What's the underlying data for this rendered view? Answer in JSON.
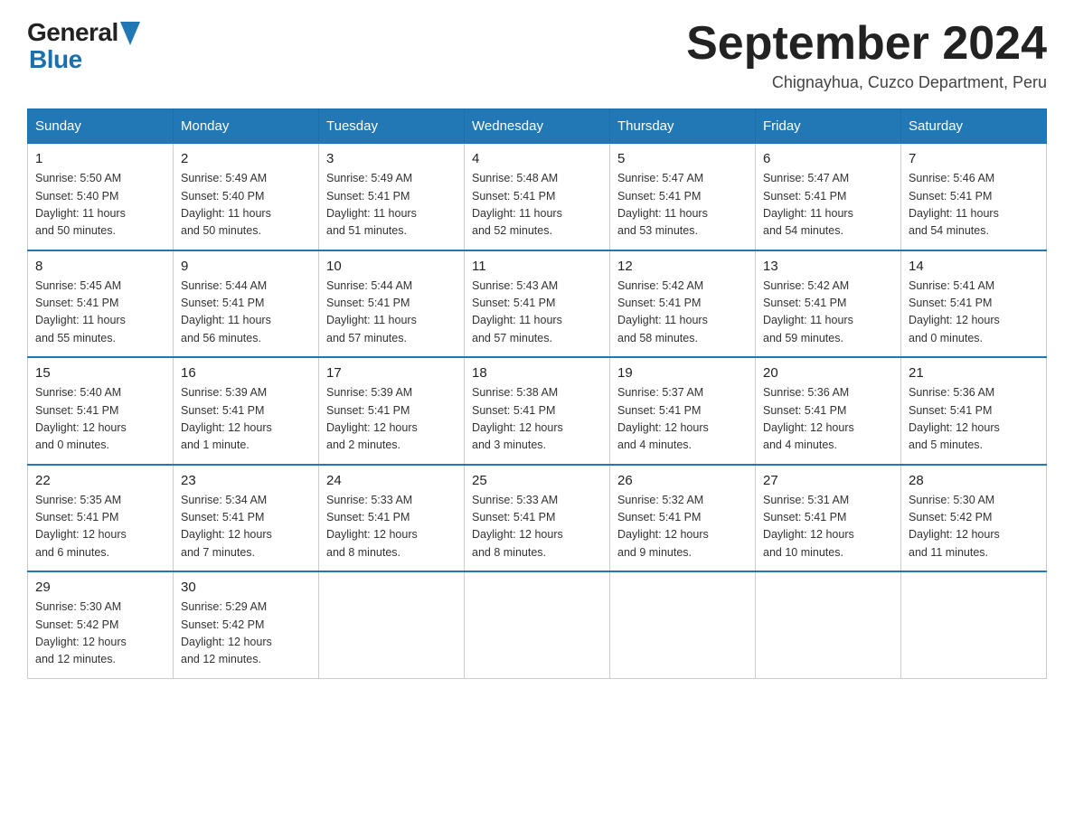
{
  "header": {
    "logo_general": "General",
    "logo_blue": "Blue",
    "title": "September 2024",
    "location": "Chignayhua, Cuzco Department, Peru"
  },
  "days_of_week": [
    "Sunday",
    "Monday",
    "Tuesday",
    "Wednesday",
    "Thursday",
    "Friday",
    "Saturday"
  ],
  "weeks": [
    [
      {
        "day": "1",
        "sunrise": "Sunrise: 5:50 AM",
        "sunset": "Sunset: 5:40 PM",
        "daylight": "Daylight: 11 hours and 50 minutes."
      },
      {
        "day": "2",
        "sunrise": "Sunrise: 5:49 AM",
        "sunset": "Sunset: 5:40 PM",
        "daylight": "Daylight: 11 hours and 50 minutes."
      },
      {
        "day": "3",
        "sunrise": "Sunrise: 5:49 AM",
        "sunset": "Sunset: 5:41 PM",
        "daylight": "Daylight: 11 hours and 51 minutes."
      },
      {
        "day": "4",
        "sunrise": "Sunrise: 5:48 AM",
        "sunset": "Sunset: 5:41 PM",
        "daylight": "Daylight: 11 hours and 52 minutes."
      },
      {
        "day": "5",
        "sunrise": "Sunrise: 5:47 AM",
        "sunset": "Sunset: 5:41 PM",
        "daylight": "Daylight: 11 hours and 53 minutes."
      },
      {
        "day": "6",
        "sunrise": "Sunrise: 5:47 AM",
        "sunset": "Sunset: 5:41 PM",
        "daylight": "Daylight: 11 hours and 54 minutes."
      },
      {
        "day": "7",
        "sunrise": "Sunrise: 5:46 AM",
        "sunset": "Sunset: 5:41 PM",
        "daylight": "Daylight: 11 hours and 54 minutes."
      }
    ],
    [
      {
        "day": "8",
        "sunrise": "Sunrise: 5:45 AM",
        "sunset": "Sunset: 5:41 PM",
        "daylight": "Daylight: 11 hours and 55 minutes."
      },
      {
        "day": "9",
        "sunrise": "Sunrise: 5:44 AM",
        "sunset": "Sunset: 5:41 PM",
        "daylight": "Daylight: 11 hours and 56 minutes."
      },
      {
        "day": "10",
        "sunrise": "Sunrise: 5:44 AM",
        "sunset": "Sunset: 5:41 PM",
        "daylight": "Daylight: 11 hours and 57 minutes."
      },
      {
        "day": "11",
        "sunrise": "Sunrise: 5:43 AM",
        "sunset": "Sunset: 5:41 PM",
        "daylight": "Daylight: 11 hours and 57 minutes."
      },
      {
        "day": "12",
        "sunrise": "Sunrise: 5:42 AM",
        "sunset": "Sunset: 5:41 PM",
        "daylight": "Daylight: 11 hours and 58 minutes."
      },
      {
        "day": "13",
        "sunrise": "Sunrise: 5:42 AM",
        "sunset": "Sunset: 5:41 PM",
        "daylight": "Daylight: 11 hours and 59 minutes."
      },
      {
        "day": "14",
        "sunrise": "Sunrise: 5:41 AM",
        "sunset": "Sunset: 5:41 PM",
        "daylight": "Daylight: 12 hours and 0 minutes."
      }
    ],
    [
      {
        "day": "15",
        "sunrise": "Sunrise: 5:40 AM",
        "sunset": "Sunset: 5:41 PM",
        "daylight": "Daylight: 12 hours and 0 minutes."
      },
      {
        "day": "16",
        "sunrise": "Sunrise: 5:39 AM",
        "sunset": "Sunset: 5:41 PM",
        "daylight": "Daylight: 12 hours and 1 minute."
      },
      {
        "day": "17",
        "sunrise": "Sunrise: 5:39 AM",
        "sunset": "Sunset: 5:41 PM",
        "daylight": "Daylight: 12 hours and 2 minutes."
      },
      {
        "day": "18",
        "sunrise": "Sunrise: 5:38 AM",
        "sunset": "Sunset: 5:41 PM",
        "daylight": "Daylight: 12 hours and 3 minutes."
      },
      {
        "day": "19",
        "sunrise": "Sunrise: 5:37 AM",
        "sunset": "Sunset: 5:41 PM",
        "daylight": "Daylight: 12 hours and 4 minutes."
      },
      {
        "day": "20",
        "sunrise": "Sunrise: 5:36 AM",
        "sunset": "Sunset: 5:41 PM",
        "daylight": "Daylight: 12 hours and 4 minutes."
      },
      {
        "day": "21",
        "sunrise": "Sunrise: 5:36 AM",
        "sunset": "Sunset: 5:41 PM",
        "daylight": "Daylight: 12 hours and 5 minutes."
      }
    ],
    [
      {
        "day": "22",
        "sunrise": "Sunrise: 5:35 AM",
        "sunset": "Sunset: 5:41 PM",
        "daylight": "Daylight: 12 hours and 6 minutes."
      },
      {
        "day": "23",
        "sunrise": "Sunrise: 5:34 AM",
        "sunset": "Sunset: 5:41 PM",
        "daylight": "Daylight: 12 hours and 7 minutes."
      },
      {
        "day": "24",
        "sunrise": "Sunrise: 5:33 AM",
        "sunset": "Sunset: 5:41 PM",
        "daylight": "Daylight: 12 hours and 8 minutes."
      },
      {
        "day": "25",
        "sunrise": "Sunrise: 5:33 AM",
        "sunset": "Sunset: 5:41 PM",
        "daylight": "Daylight: 12 hours and 8 minutes."
      },
      {
        "day": "26",
        "sunrise": "Sunrise: 5:32 AM",
        "sunset": "Sunset: 5:41 PM",
        "daylight": "Daylight: 12 hours and 9 minutes."
      },
      {
        "day": "27",
        "sunrise": "Sunrise: 5:31 AM",
        "sunset": "Sunset: 5:41 PM",
        "daylight": "Daylight: 12 hours and 10 minutes."
      },
      {
        "day": "28",
        "sunrise": "Sunrise: 5:30 AM",
        "sunset": "Sunset: 5:42 PM",
        "daylight": "Daylight: 12 hours and 11 minutes."
      }
    ],
    [
      {
        "day": "29",
        "sunrise": "Sunrise: 5:30 AM",
        "sunset": "Sunset: 5:42 PM",
        "daylight": "Daylight: 12 hours and 12 minutes."
      },
      {
        "day": "30",
        "sunrise": "Sunrise: 5:29 AM",
        "sunset": "Sunset: 5:42 PM",
        "daylight": "Daylight: 12 hours and 12 minutes."
      },
      null,
      null,
      null,
      null,
      null
    ]
  ]
}
